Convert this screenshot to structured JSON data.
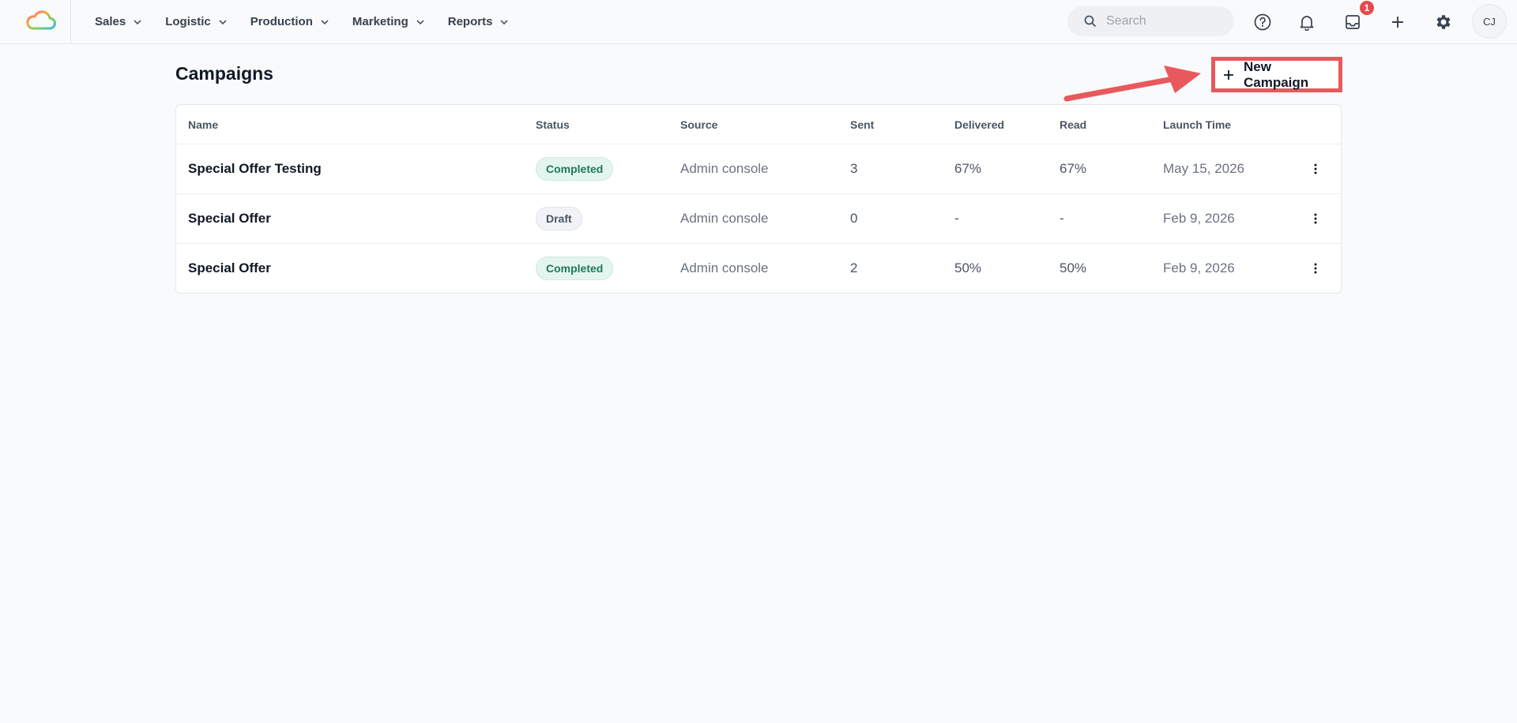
{
  "nav": {
    "items": [
      {
        "label": "Sales"
      },
      {
        "label": "Logistic"
      },
      {
        "label": "Production"
      },
      {
        "label": "Marketing"
      },
      {
        "label": "Reports"
      }
    ]
  },
  "topbar": {
    "search_placeholder": "Search",
    "inbox_badge": "1",
    "avatar_initials": "CJ",
    "icons": [
      "search-icon",
      "help-icon",
      "bell-icon",
      "inbox-icon",
      "plus-icon",
      "gear-icon"
    ]
  },
  "page": {
    "title": "Campaigns",
    "new_button_label": "New Campaign"
  },
  "table": {
    "headers": {
      "name": "Name",
      "status": "Status",
      "source": "Source",
      "sent": "Sent",
      "delivered": "Delivered",
      "read": "Read",
      "launch_time": "Launch Time"
    },
    "rows": [
      {
        "name": "Special Offer Testing",
        "status": "Completed",
        "source": "Admin console",
        "sent": "3",
        "delivered": "67%",
        "read": "67%",
        "launch_time": "May 15, 2026"
      },
      {
        "name": "Special Offer",
        "status": "Draft",
        "source": "Admin console",
        "sent": "0",
        "delivered": "-",
        "read": "-",
        "launch_time": "Feb 9, 2026"
      },
      {
        "name": "Special Offer",
        "status": "Completed",
        "source": "Admin console",
        "sent": "2",
        "delivered": "50%",
        "read": "50%",
        "launch_time": "Feb 9, 2026"
      }
    ]
  },
  "colors": {
    "annotation": "#e8595d",
    "completed_bg": "#e4f4ef",
    "completed_text": "#1e7a5a",
    "draft_bg": "#f1f3f6",
    "badge": "#e5484d"
  }
}
